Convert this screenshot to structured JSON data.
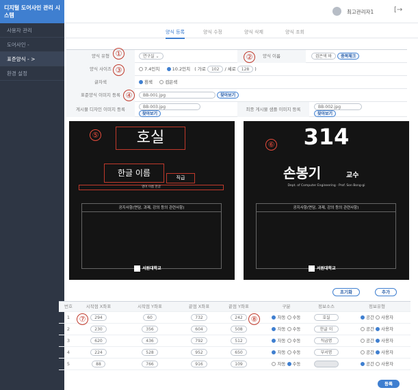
{
  "sidebar": {
    "title": "디지털 도어사인 관리 시스템",
    "items": [
      "사용자 관리",
      "도어사인 -",
      "표준양식 - >",
      "환경 설정"
    ]
  },
  "topbar": {
    "admin": "최고관리자1",
    "logout": "[→"
  },
  "tabs": [
    "양식 등록",
    "양식 수정",
    "양식 삭제",
    "양식 조회"
  ],
  "form": {
    "type_label": "양식 유형",
    "type_value": "연구실",
    "name_label": "양식 이름",
    "name_value": "검은색 바",
    "dup_check": "중복체크",
    "size_label": "양식 사이즈",
    "size_opt1": "7.4인치",
    "size_opt2": "10.2인치",
    "size_paren_open": "( 가로",
    "width_value": "102",
    "size_sep": "/ 세로",
    "height_value": "128",
    "size_paren_close": ")",
    "color_label": "글자색",
    "color_opt1": "흰색",
    "color_opt2": "검은색",
    "std_img_label": "표준양식 이미지 등록",
    "std_img_value": "BB-001.jpg",
    "browse": "찾아보기",
    "design_img_label": "게시물 디자인 이미지 등록",
    "design_img_value": "BB-003.jpg",
    "final_img_label": "최종 게시물 샘플 이미지 등록",
    "final_img_value": "BB-002.jpg"
  },
  "markers": [
    "①",
    "②",
    "③",
    "④",
    "⑤",
    "⑥",
    "⑦",
    "⑧"
  ],
  "preview_left": {
    "room": "호실",
    "name": "한글 이름",
    "rank": "직급",
    "eng": "영어 이름 한글",
    "notice": "공지사항(면담, 과제, 강의 등의 관련사항)",
    "logo": "서원대학교"
  },
  "preview_right": {
    "room": "314",
    "name": "손봉기",
    "rank": "교수",
    "eng": "Dept. of Computer Engineering · Prof. Son Bong-gi",
    "notice": "공지사항(면담, 과제, 강의 등의 관련사항)",
    "logo": "서원대학교"
  },
  "actions": {
    "reset": "초기화",
    "add": "추가",
    "register": "등록"
  },
  "table": {
    "headers": [
      "번호",
      "시작점 X좌표",
      "시작점 Y좌표",
      "끝점 X좌표",
      "끝점 Y좌표",
      "구분",
      "정보소스",
      "정보유형"
    ],
    "mode_auto": "자동",
    "mode_manual": "수동",
    "type_space": "공간",
    "type_user": "사용자",
    "rows": [
      {
        "no": "1",
        "sx": "294",
        "sy": "60",
        "ex": "732",
        "ey": "242",
        "mode": "auto",
        "source": "호실",
        "type": "space"
      },
      {
        "no": "2",
        "sx": "230",
        "sy": "356",
        "ex": "604",
        "ey": "508",
        "mode": "auto",
        "source": "한글 이",
        "type": "user"
      },
      {
        "no": "3",
        "sx": "620",
        "sy": "436",
        "ex": "792",
        "ey": "512",
        "mode": "auto",
        "source": "직급명",
        "type": "user"
      },
      {
        "no": "4",
        "sx": "224",
        "sy": "528",
        "ex": "952",
        "ey": "650",
        "mode": "auto",
        "source": "부서명",
        "type": "user"
      },
      {
        "no": "5",
        "sx": "88",
        "sy": "766",
        "ex": "916",
        "ey": "109",
        "mode": "manual",
        "source": "",
        "type": "space"
      }
    ]
  }
}
